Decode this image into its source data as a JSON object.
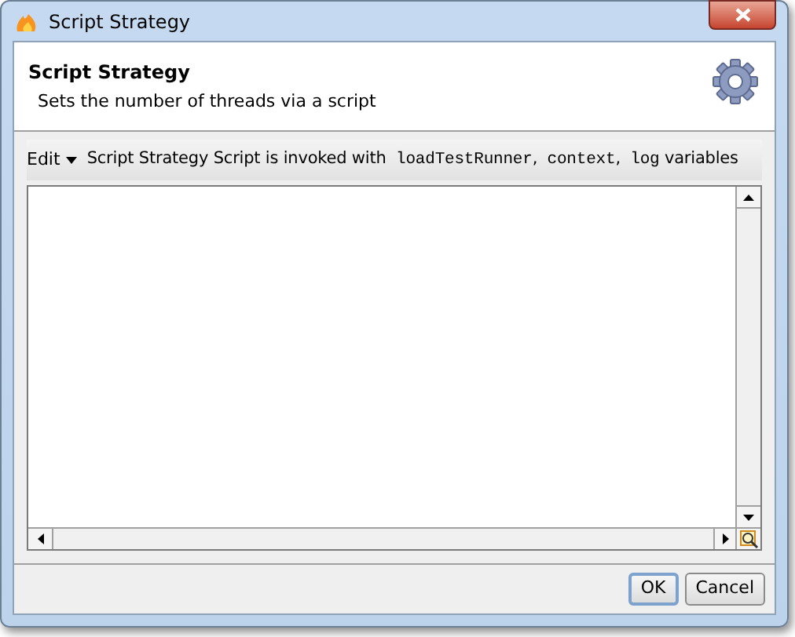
{
  "window": {
    "title": "Script Strategy"
  },
  "header": {
    "title": "Script Strategy",
    "description": "Sets the number of threads via a script"
  },
  "toolbar": {
    "edit_menu": "Edit",
    "hint": [
      {
        "kind": "text",
        "text": "Script Strategy Script is invoked with"
      },
      {
        "kind": "code",
        "text": "loadTestRunner"
      },
      {
        "kind": "text",
        "text": ","
      },
      {
        "kind": "code",
        "text": "context"
      },
      {
        "kind": "text",
        "text": ","
      },
      {
        "kind": "code",
        "text": "log"
      },
      {
        "kind": "text",
        "text": "variables"
      }
    ]
  },
  "buttons": [
    {
      "label": "OK",
      "selected": true
    },
    {
      "label": "Cancel",
      "selected": false
    }
  ]
}
